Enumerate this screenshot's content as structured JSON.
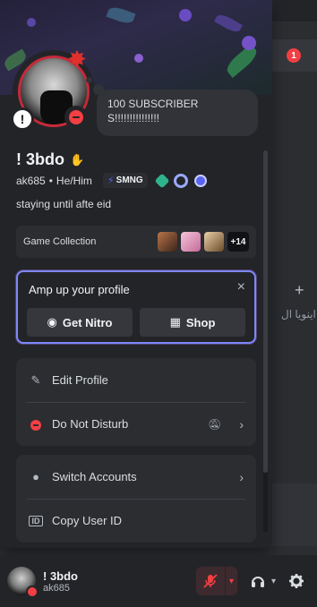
{
  "background": {
    "notification_count": "1",
    "plus_icon": "+",
    "channel_preview_text": "اينويا ال"
  },
  "profile": {
    "custom_status": "100 SUBSCRIBERS!!!!!!!!!!!!!!!",
    "display_name": "! 3bdo",
    "username": "ak685",
    "pronouns": "He/Him",
    "separator": "•",
    "guild_tag": "SMNG",
    "bio": "staying until afte eid",
    "speech_icon": "!",
    "status": "do-not-disturb",
    "accent_color": "#c52a3a"
  },
  "game_collection": {
    "label": "Game Collection",
    "more_count": "+14"
  },
  "nitro_promo": {
    "title": "Amp up your profile",
    "close": "×",
    "get_nitro_label": "Get Nitro",
    "shop_label": "Shop"
  },
  "menu": {
    "edit_profile": "Edit Profile",
    "do_not_disturb": "Do Not Disturb",
    "switch_accounts": "Switch Accounts",
    "copy_user_id": "Copy User ID"
  },
  "user_panel": {
    "name": "! 3bdo",
    "username": "ak685"
  },
  "colors": {
    "dnd_red": "#f23f43",
    "nitro_border": "#7e88f7",
    "panel_bg": "#232428",
    "card_bg": "#2b2d31"
  }
}
